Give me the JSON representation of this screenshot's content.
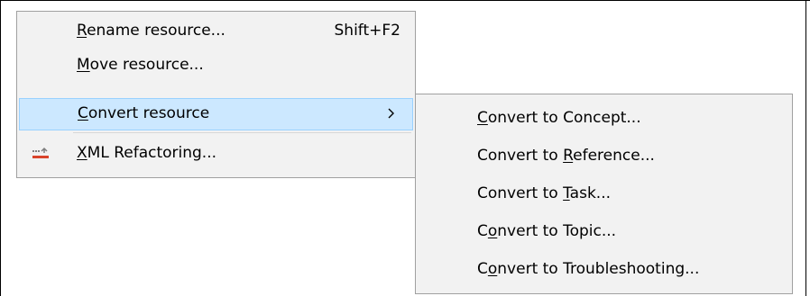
{
  "context_menu": {
    "items": [
      {
        "prefix": "",
        "accel": "R",
        "suffix": "ename resource...",
        "shortcut": "Shift+F2"
      },
      {
        "prefix": "",
        "accel": "M",
        "suffix": "ove resource..."
      },
      {
        "prefix": "",
        "accel": "C",
        "suffix": "onvert resource",
        "submenu_arrow": ">"
      },
      {
        "prefix": "",
        "accel": "X",
        "suffix": "ML Refactoring...",
        "icon": "xml-refactoring-icon"
      }
    ]
  },
  "submenu": {
    "items": [
      {
        "prefix": "",
        "accel": "C",
        "suffix": "onvert to Concept..."
      },
      {
        "prefix": "Convert to ",
        "accel": "R",
        "suffix": "eference..."
      },
      {
        "prefix": "Convert to ",
        "accel": "T",
        "suffix": "ask..."
      },
      {
        "prefix": "C",
        "accel": "o",
        "suffix": "nvert to Topic..."
      },
      {
        "prefix": "C",
        "accel": "o",
        "suffix": "nvert to Troubleshooting..."
      }
    ]
  },
  "colors": {
    "menu_background": "#f2f2f2",
    "highlight": "#cce8ff",
    "highlight_border": "#99d1ff",
    "icon_red": "#d9442b"
  }
}
